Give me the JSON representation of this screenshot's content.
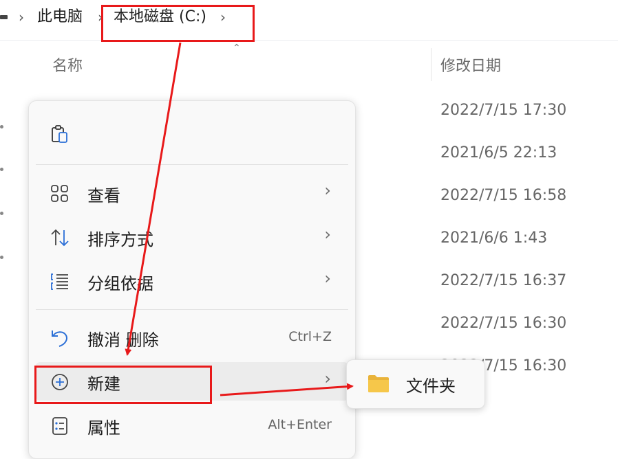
{
  "breadcrumb": {
    "items": [
      "此电脑",
      "本地磁盘 (C:)"
    ],
    "separator": "›"
  },
  "columns": {
    "name": "名称",
    "modified": "修改日期"
  },
  "dates": [
    "2022/7/15 17:30",
    "2021/6/5 22:13",
    "2022/7/15 16:58",
    "2021/6/6 1:43",
    "2022/7/15 16:37",
    "2022/7/15 16:30",
    "2022/7/15 16:30"
  ],
  "context_menu": {
    "items": [
      {
        "label": "查看",
        "icon": "grid-view-icon",
        "chevron": "›"
      },
      {
        "label": "排序方式",
        "icon": "sort-arrows-icon",
        "chevron": "›"
      },
      {
        "label": "分组依据",
        "icon": "group-list-icon",
        "chevron": "›"
      },
      {
        "label": "撤消 删除",
        "icon": "undo-icon",
        "shortcut": "Ctrl+Z"
      },
      {
        "label": "新建",
        "icon": "new-plus-icon",
        "chevron": "›"
      },
      {
        "label": "属性",
        "icon": "properties-icon",
        "shortcut": "Alt+Enter"
      }
    ]
  },
  "submenu": {
    "items": [
      {
        "label": "文件夹",
        "icon": "folder-icon"
      }
    ]
  },
  "colors": {
    "annotation": "#e8191a",
    "menu_bg": "#f9f9f9",
    "folder_yellow": "#f6c74a"
  }
}
